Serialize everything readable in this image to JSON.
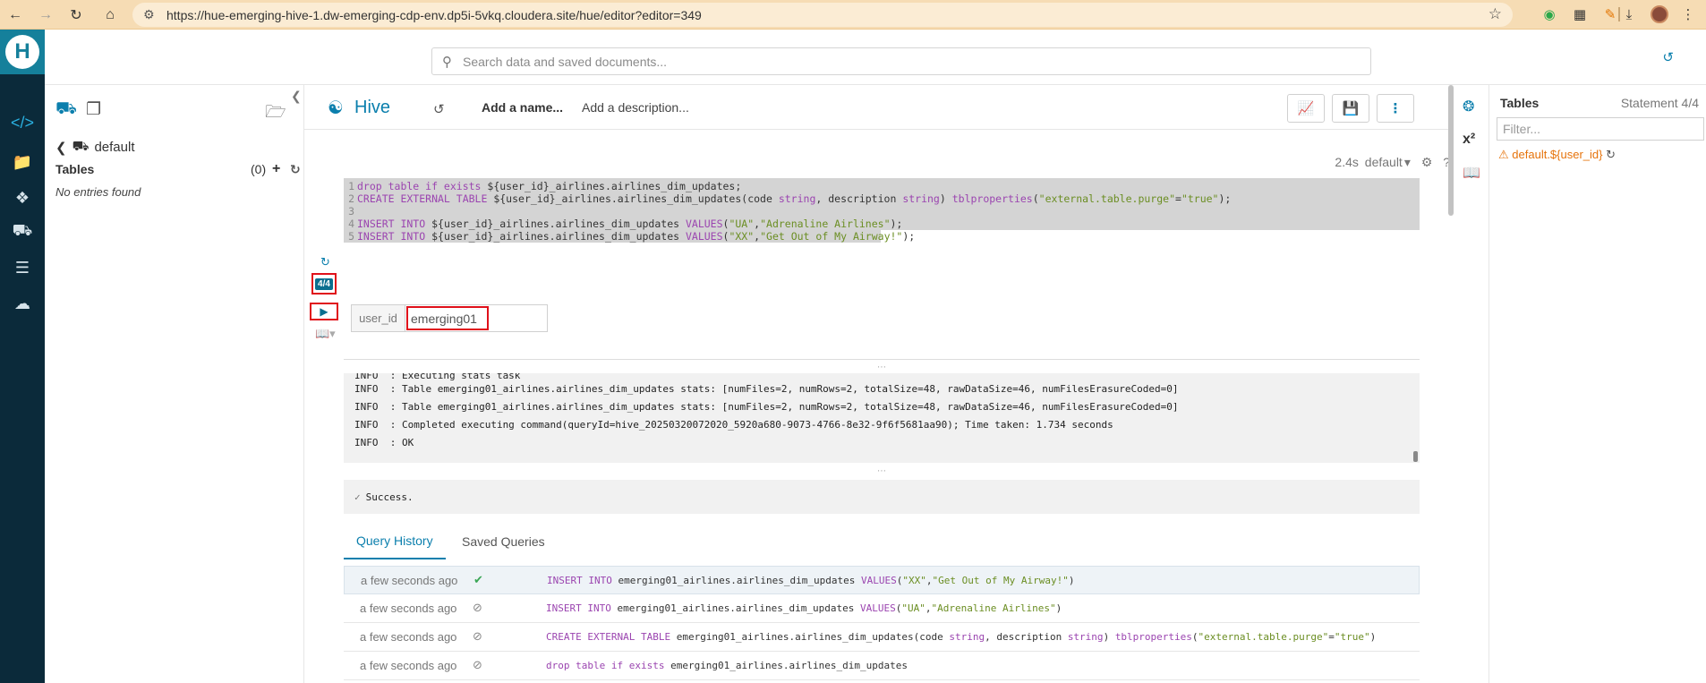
{
  "browser": {
    "url": "https://hue-emerging-hive-1.dw-emerging-cdp-env.dp5i-5vkq.cloudera.site/hue/editor?editor=349"
  },
  "search": {
    "placeholder": "Search data and saved documents..."
  },
  "assist": {
    "database": "default",
    "tables_label": "Tables",
    "tables_count": "(0)",
    "no_entries": "No entries found"
  },
  "editor": {
    "engine": "Hive",
    "add_name": "Add a name...",
    "add_description": "Add a description...",
    "exec_time": "2.4s",
    "database": "default",
    "statement_badge": "4/4",
    "code_lines": [
      {
        "n": "1",
        "text": "drop table if exists ${user_id}_airlines.airlines_dim_updates;"
      },
      {
        "n": "2",
        "text": "CREATE EXTERNAL TABLE ${user_id}_airlines.airlines_dim_updates(code string, description string) tblproperties(\"external.table.purge\"=\"true\");"
      },
      {
        "n": "3",
        "text": ""
      },
      {
        "n": "4",
        "text": "INSERT INTO ${user_id}_airlines.airlines_dim_updates VALUES(\"UA\",\"Adrenaline Airlines\");"
      },
      {
        "n": "5",
        "text": "INSERT INTO ${user_id}_airlines.airlines_dim_updates VALUES(\"XX\",\"Get Out of My Airway!\");"
      }
    ],
    "param_name": "user_id",
    "param_value": "emerging01"
  },
  "log": {
    "lines": [
      "INFO  : Executing stats task",
      "INFO  : Table emerging01_airlines.airlines_dim_updates stats: [numFiles=2, numRows=2, totalSize=48, rawDataSize=46, numFilesErasureCoded=0]",
      "INFO  : Table emerging01_airlines.airlines_dim_updates stats: [numFiles=2, numRows=2, totalSize=48, rawDataSize=46, numFilesErasureCoded=0]",
      "INFO  : Completed executing command(queryId=hive_20250320072020_5920a680-9073-4766-8e32-9f6f5681aa90); Time taken: 1.734 seconds",
      "INFO  : OK"
    ],
    "status": "Success."
  },
  "tabs": {
    "query_history": "Query History",
    "saved_queries": "Saved Queries"
  },
  "history": [
    {
      "time": "a few seconds ago",
      "status": "success",
      "query": "INSERT INTO emerging01_airlines.airlines_dim_updates VALUES(\"XX\",\"Get Out of My Airway!\")"
    },
    {
      "time": "a few seconds ago",
      "status": "expired",
      "query": "INSERT INTO emerging01_airlines.airlines_dim_updates VALUES(\"UA\",\"Adrenaline Airlines\")"
    },
    {
      "time": "a few seconds ago",
      "status": "expired",
      "query": "CREATE EXTERNAL TABLE emerging01_airlines.airlines_dim_updates(code string, description string) tblproperties(\"external.table.purge\"=\"true\")"
    },
    {
      "time": "a few seconds ago",
      "status": "expired",
      "query": "drop table if exists emerging01_airlines.airlines_dim_updates"
    }
  ],
  "right_panel": {
    "title": "Tables",
    "statement": "Statement 4/4",
    "filter_placeholder": "Filter...",
    "warning_table": "default.${user_id}"
  },
  "colors": {
    "accent": "#0b7fad",
    "navbar": "#0b2a3a",
    "highlight": "#e0101a",
    "warning": "#e6730b"
  }
}
